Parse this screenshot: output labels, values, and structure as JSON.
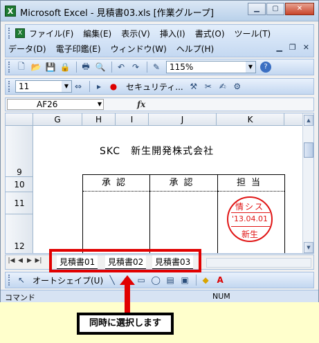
{
  "window": {
    "title": "Microsoft Excel - 見積書03.xls  [作業グループ]",
    "app_icon_letter": "X",
    "controls": [
      "minimize",
      "maximize",
      "close"
    ]
  },
  "menu": {
    "row1": [
      "ファイル(F)",
      "編集(E)",
      "表示(V)",
      "挿入(I)",
      "書式(O)",
      "ツール(T)"
    ],
    "row2": [
      "データ(D)",
      "電子印鑑(E)",
      "ウィンドウ(W)",
      "ヘルプ(H)"
    ]
  },
  "toolbar": {
    "zoom": "115%",
    "font_size": "11",
    "security_label": "セキュリティ..."
  },
  "formula_bar": {
    "name_box": "AF26",
    "fx": "fx"
  },
  "sheet": {
    "columns": [
      "G",
      "H",
      "I",
      "J",
      "K"
    ],
    "rows": [
      "9",
      "10",
      "11",
      "12"
    ],
    "company": "SKC　新生開発株式会社",
    "approval_headers": [
      "承認",
      "承認",
      "担当"
    ],
    "stamp": {
      "line1": "情シス",
      "line2": "'13.04.01",
      "line3": "新生",
      "color": "#e01414"
    }
  },
  "tabs": [
    "見積書01",
    "見積書02",
    "見積書03"
  ],
  "drawing_toolbar": {
    "autoshape_label": "オートシェイプ(U)"
  },
  "status": {
    "mode": "コマンド",
    "num": "NUM"
  },
  "annotation": {
    "callout": "同時に選択します",
    "highlight_color": "#e10000"
  }
}
